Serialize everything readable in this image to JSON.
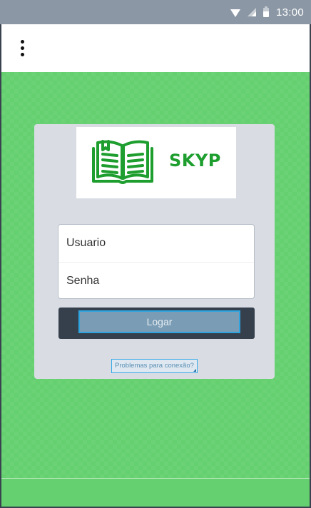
{
  "status_bar": {
    "time": "13:00",
    "icons": [
      "wifi-icon",
      "signal-icon",
      "battery-icon"
    ]
  },
  "app_bar": {
    "menu_icon": "more-vertical-icon"
  },
  "login_card": {
    "logo_text": "SKYP",
    "logo_icon": "open-book-icon",
    "username": {
      "value": "",
      "placeholder": "Usuario"
    },
    "password": {
      "value": "",
      "placeholder": "Senha"
    },
    "login_label": "Logar",
    "problem_link": "Problemas para conexão?"
  },
  "colors": {
    "background_green": "#64d06f",
    "logo_green": "#1e9e2e",
    "card_bg": "#d9dde3",
    "button_bg": "#7a9cb5",
    "button_border": "#2fa5e0"
  }
}
